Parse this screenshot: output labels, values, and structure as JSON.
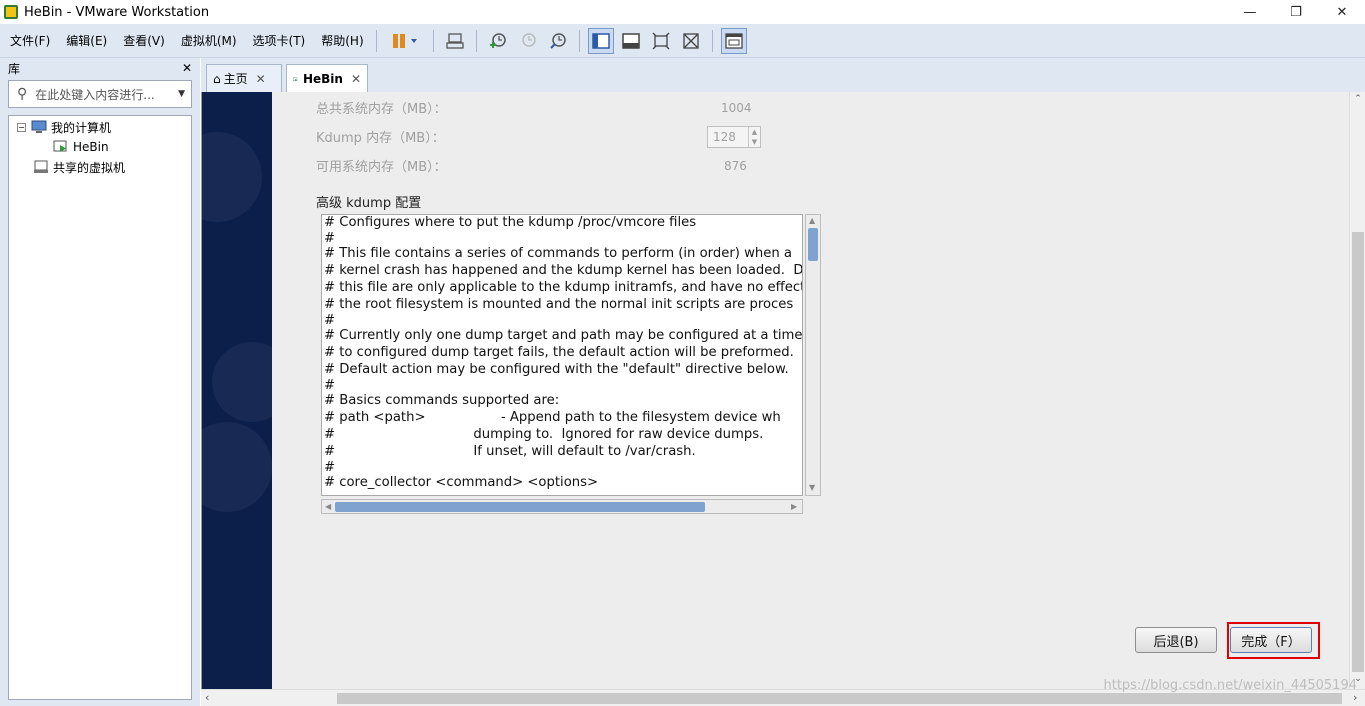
{
  "window": {
    "title": "HeBin - VMware Workstation",
    "minimize_glyph": "—",
    "restore_glyph": "❐",
    "close_glyph": "✕"
  },
  "menu": {
    "file": "文件(F)",
    "edit": "编辑(E)",
    "view": "查看(V)",
    "vm": "虚拟机(M)",
    "tabs": "选项卡(T)",
    "help": "帮助(H)"
  },
  "toolbar": {
    "icons": [
      "pause-icon",
      "send-keys-icon",
      "snapshot-icon",
      "revert-snapshot-icon",
      "snapshot-manager-icon",
      "library-view-icon",
      "thumbnail-view-icon",
      "fullscreen-icon",
      "unity-icon",
      "console-view-icon"
    ],
    "active_color": "#c9daf2"
  },
  "library": {
    "title": "库",
    "close_glyph": "✕",
    "search_placeholder": "在此处键入内容进行...",
    "tree": {
      "my_computer": "我的计算机",
      "vm_name": "HeBin",
      "shared_vms": "共享的虚拟机",
      "collapse_glyph": "−"
    }
  },
  "tabs": [
    {
      "label": "主页",
      "close": "✕"
    },
    {
      "label": "HeBin",
      "close": "✕"
    }
  ],
  "kdump": {
    "total_memory_label": "总共系统内存（MB）：",
    "total_memory_value": "1004",
    "kdump_memory_label": "Kdump 内存（MB）：",
    "kdump_memory_value": "128",
    "usable_memory_label": "可用系统内存（MB）：",
    "usable_memory_value": "876",
    "advanced_title": "高级 kdump 配置",
    "config_lines": [
      "# Configures where to put the kdump /proc/vmcore files",
      "#",
      "# This file contains a series of commands to perform (in order) when a",
      "# kernel crash has happened and the kdump kernel has been loaded.  Di",
      "# this file are only applicable to the kdump initramfs, and have no effect",
      "# the root filesystem is mounted and the normal init scripts are proces",
      "#",
      "# Currently only one dump target and path may be configured at a time",
      "# to configured dump target fails, the default action will be preformed.",
      "# Default action may be configured with the \"default\" directive below.",
      "#",
      "# Basics commands supported are:",
      "# path <path>                  - Append path to the filesystem device wh",
      "#                                 dumping to.  Ignored for raw device dumps.",
      "#                                 If unset, will default to /var/crash.",
      "#",
      "# core_collector <command> <options>"
    ],
    "back_button": "后退(B)",
    "finish_button": "完成（F）"
  },
  "watermark": "https://blog.csdn.net/weixin_44505194",
  "colors": {
    "vm_sidebar": "#0c1f4a",
    "highlight": "#e00000",
    "scroll_thumb": "#7fa2cf"
  }
}
